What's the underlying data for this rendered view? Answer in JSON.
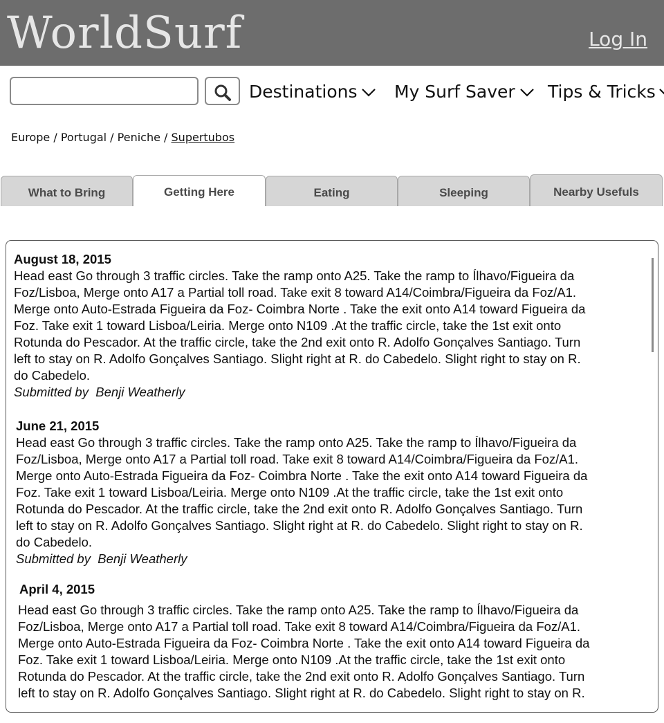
{
  "header": {
    "logo": "WorldSurf",
    "login_label": "Log In"
  },
  "search": {
    "value": "",
    "placeholder": ""
  },
  "nav": {
    "items": [
      {
        "label": "Destinations"
      },
      {
        "label": "My Surf Saver"
      },
      {
        "label": "Tips & Tricks"
      }
    ]
  },
  "breadcrumb": {
    "parts": [
      "Europe",
      "Portugal",
      "Peniche",
      "Supertubos"
    ],
    "separator": " / "
  },
  "tabs": [
    {
      "label": "What to Bring"
    },
    {
      "label": "Getting Here"
    },
    {
      "label": "Eating"
    },
    {
      "label": "Sleeping"
    },
    {
      "label": "Nearby Usefuls"
    }
  ],
  "active_tab": "Getting Here",
  "entries": [
    {
      "date": "August 18, 2015",
      "lines": [
        "Head east Go through 3 traffic circles. Take the ramp onto A25. Take the ramp to Ílhavo/Figueira da",
        "Foz/Lisboa, Merge onto A17 a Partial toll road. Take exit 8 toward A14/Coimbra/Figueira da Foz/A1.",
        "Merge onto Auto-Estrada Figueira da Foz- Coimbra Norte . Take the exit onto A14 toward Figueira da",
        "Foz. Take exit 1 toward Lisboa/Leiria. Merge onto N109 .At the traffic circle, take the 1st exit onto",
        "Rotunda do Pescador. At the traffic circle, take the 2nd exit onto R. Adolfo Gonçalves Santiago. Turn",
        "left to stay on R. Adolfo Gonçalves Santiago. Slight right at R. do Cabedelo. Slight right to stay on R.",
        "do Cabedelo."
      ],
      "author": "Submitted by  Benji Weatherly"
    },
    {
      "date": "June 21, 2015",
      "lines": [
        "Head east Go through 3 traffic circles. Take the ramp onto A25. Take the ramp to Ílhavo/Figueira da",
        "Foz/Lisboa, Merge onto A17 a Partial toll road. Take exit 8 toward A14/Coimbra/Figueira da Foz/A1.",
        "Merge onto Auto-Estrada Figueira da Foz- Coimbra Norte . Take the exit onto A14 toward Figueira da",
        "Foz. Take exit 1 toward Lisboa/Leiria. Merge onto N109 .At the traffic circle, take the 1st exit onto",
        "Rotunda do Pescador. At the traffic circle, take the 2nd exit onto R. Adolfo Gonçalves Santiago. Turn",
        "left to stay on R. Adolfo Gonçalves Santiago. Slight right at R. do Cabedelo. Slight right to stay on R.",
        "do Cabedelo."
      ],
      "author": "Submitted by  Benji Weatherly"
    },
    {
      "date": "April 4, 2015",
      "lines": [
        "Head east Go through 3 traffic circles. Take the ramp onto A25. Take the ramp to Ílhavo/Figueira da",
        "Foz/Lisboa, Merge onto A17 a Partial toll road. Take exit 8 toward A14/Coimbra/Figueira da Foz/A1.",
        "Merge onto Auto-Estrada Figueira da Foz- Coimbra Norte . Take the exit onto A14 toward Figueira da",
        "Foz. Take exit 1 toward Lisboa/Leiria. Merge onto N109 .At the traffic circle, take the 1st exit onto",
        "Rotunda do Pescador. At the traffic circle, take the 2nd exit onto R. Adolfo Gonçalves Santiago. Turn",
        "left to stay on R. Adolfo Gonçalves Santiago. Slight right at R. do Cabedelo. Slight right to stay on R."
      ],
      "author": ""
    }
  ]
}
